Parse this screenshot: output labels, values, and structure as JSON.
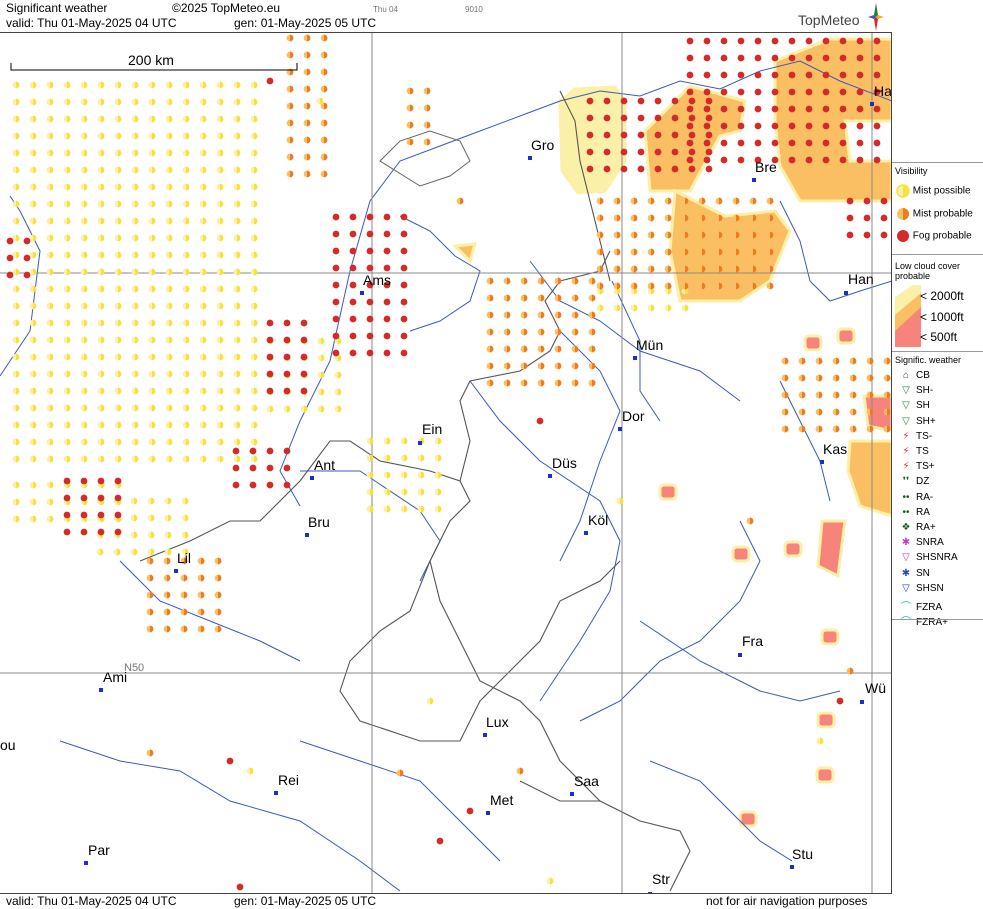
{
  "header": {
    "title": "Significant weather",
    "copyright": "©2025 TopMeteo.eu",
    "valid": "valid:  Thu  01-May-2025  04 UTC",
    "gen": "gen: 01-May-2025 05 UTC",
    "small_day": "Thu 04",
    "small_code": "9010",
    "logo": "TopMeteo"
  },
  "footer": {
    "valid": "valid:  Thu  01-May-2025  04 UTC",
    "gen": "gen: 01-May-2025 05 UTC",
    "disclaimer": "not for air navigation purposes"
  },
  "map": {
    "scale_label": "200 km",
    "lat_label": "N50",
    "cities": [
      {
        "name": "Ha"
      },
      {
        "name": "Gro"
      },
      {
        "name": "Bre"
      },
      {
        "name": "Ams"
      },
      {
        "name": "Han"
      },
      {
        "name": "Mün"
      },
      {
        "name": "Ein"
      },
      {
        "name": "Dor"
      },
      {
        "name": "Ant"
      },
      {
        "name": "Kas"
      },
      {
        "name": "Düs"
      },
      {
        "name": "Bru"
      },
      {
        "name": "Köl"
      },
      {
        "name": "Lil"
      },
      {
        "name": "Fra"
      },
      {
        "name": "Ami"
      },
      {
        "name": "Wü"
      },
      {
        "name": "Lux"
      },
      {
        "name": "ou"
      },
      {
        "name": "Rei"
      },
      {
        "name": "Saa"
      },
      {
        "name": "Met"
      },
      {
        "name": "Par"
      },
      {
        "name": "Stu"
      },
      {
        "name": "Str"
      }
    ]
  },
  "legend": {
    "visibility_title": "Visibility",
    "visibility": [
      "Mist possible",
      "Mist probable",
      "Fog probable"
    ],
    "cloud_title_1": "Low cloud cover",
    "cloud_title_2": "probable",
    "cloud": [
      "< 2000ft",
      "< 1000ft",
      "<   500ft"
    ],
    "sig_title": "Signific. weather",
    "sig": [
      "CB",
      "SH-",
      "SH",
      "SH+",
      "TS-",
      "TS",
      "TS+",
      "DZ",
      "RA-",
      "RA",
      "RA+",
      "SNRA",
      "SHSNRA",
      "SN",
      "SHSN",
      "FZRA",
      "FZRA+"
    ]
  },
  "colors": {
    "mist_possible": "#f5e23a",
    "mist_probable": "#f07a20",
    "fog_probable": "#d42a2a",
    "cloud_2000": "#fbf0a8",
    "cloud_1000": "#fbbf63",
    "cloud_500": "#f7847a"
  }
}
